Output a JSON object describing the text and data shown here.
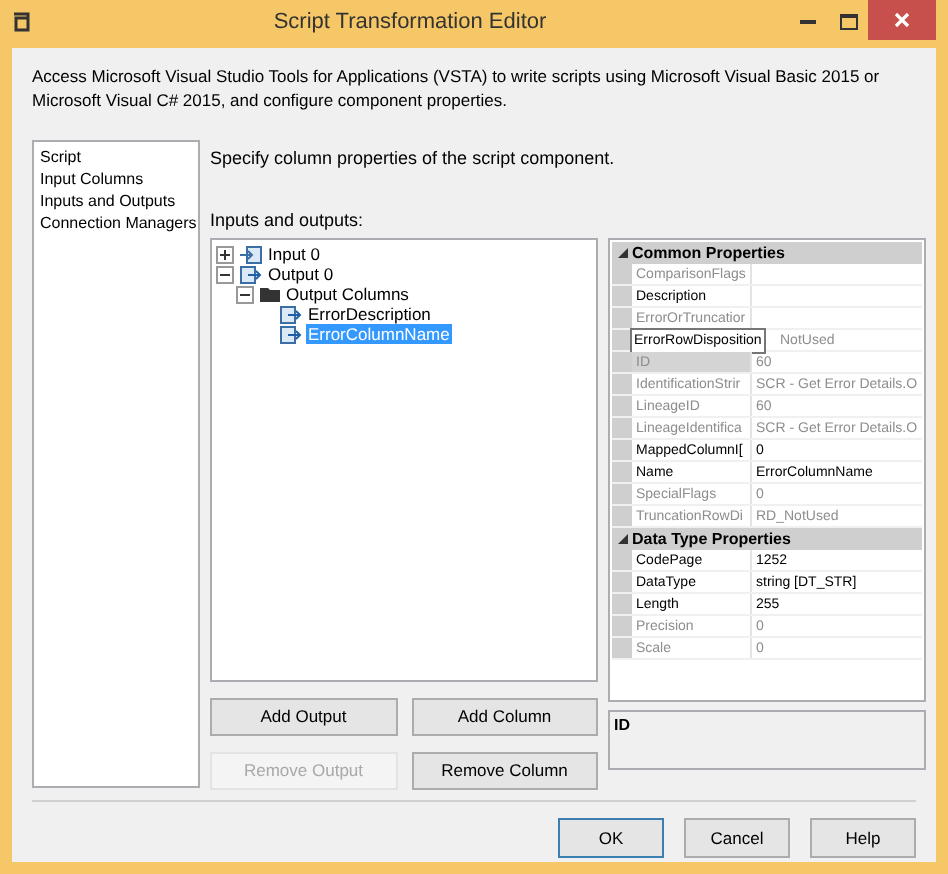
{
  "window": {
    "title": "Script Transformation Editor"
  },
  "description": "Access Microsoft Visual Studio Tools for Applications (VSTA) to write scripts using Microsoft Visual Basic 2015 or Microsoft Visual C# 2015, and configure component properties.",
  "sidebar": {
    "items": [
      {
        "label": "Script"
      },
      {
        "label": "Input Columns"
      },
      {
        "label": "Inputs and Outputs"
      },
      {
        "label": "Connection Managers"
      }
    ]
  },
  "prompt": "Specify column properties of the script component.",
  "tree_label": "Inputs and outputs:",
  "tree": [
    {
      "label": "Input 0",
      "kind": "input",
      "expanded": false,
      "selected": false
    },
    {
      "label": "Output 0",
      "kind": "output",
      "expanded": true,
      "selected": false,
      "children": [
        {
          "label": "Output Columns",
          "kind": "folder",
          "expanded": true,
          "selected": false,
          "children": [
            {
              "label": "ErrorDescription",
              "kind": "column",
              "selected": false
            },
            {
              "label": "ErrorColumnName",
              "kind": "column",
              "selected": true
            }
          ]
        }
      ]
    }
  ],
  "properties": [
    {
      "title": "Common Properties",
      "expanded": true,
      "rows": [
        {
          "name": "ComparisonFlags",
          "disabled": true,
          "selected": false
        },
        {
          "name": "Description",
          "disabled": false,
          "selected": false
        },
        {
          "name": "ErrorOrTruncatior",
          "disabled": true,
          "selected": false
        },
        {
          "tooltip": "ErrorRowDisposition",
          "value": "NotUsed",
          "disabled": true
        },
        {
          "name": "ID",
          "value": "60",
          "disabled": true,
          "selected": true
        },
        {
          "name": "IdentificationStrir",
          "value": "SCR - Get Error Details.O",
          "disabled": true,
          "selected": false
        },
        {
          "name": "LineageID",
          "value": "60",
          "disabled": true,
          "selected": false
        },
        {
          "name": "LineageIdentifica",
          "value": "SCR - Get Error Details.O",
          "disabled": true,
          "selected": false
        },
        {
          "name": "MappedColumnI[",
          "value": "0",
          "disabled": false,
          "selected": false
        },
        {
          "name": "Name",
          "value": "ErrorColumnName",
          "disabled": false,
          "selected": false
        },
        {
          "name": "SpecialFlags",
          "value": "0",
          "disabled": true,
          "selected": false
        },
        {
          "name": "TruncationRowDi",
          "value": "RD_NotUsed",
          "disabled": true,
          "selected": false
        }
      ]
    },
    {
      "title": "Data Type Properties",
      "expanded": true,
      "rows": [
        {
          "name": "CodePage",
          "value": "1252",
          "disabled": false,
          "selected": false
        },
        {
          "name": "DataType",
          "value": "string [DT_STR]",
          "disabled": false,
          "selected": false
        },
        {
          "name": "Length",
          "value": "255",
          "disabled": false,
          "selected": false
        },
        {
          "name": "Precision",
          "value": "0",
          "disabled": true,
          "selected": false
        },
        {
          "name": "Scale",
          "value": "0",
          "disabled": true,
          "selected": false
        }
      ]
    }
  ],
  "property_description": {
    "title": "ID"
  },
  "column_buttons": [
    {
      "label": "Add Output",
      "disabled": false
    },
    {
      "label": "Add Column",
      "disabled": false
    },
    {
      "label": "Remove Output",
      "disabled": true
    },
    {
      "label": "Remove Column",
      "disabled": false
    }
  ],
  "dialog_buttons": [
    {
      "label": "OK",
      "default": true
    },
    {
      "label": "Cancel",
      "default": false
    },
    {
      "label": "Help",
      "default": false
    }
  ]
}
